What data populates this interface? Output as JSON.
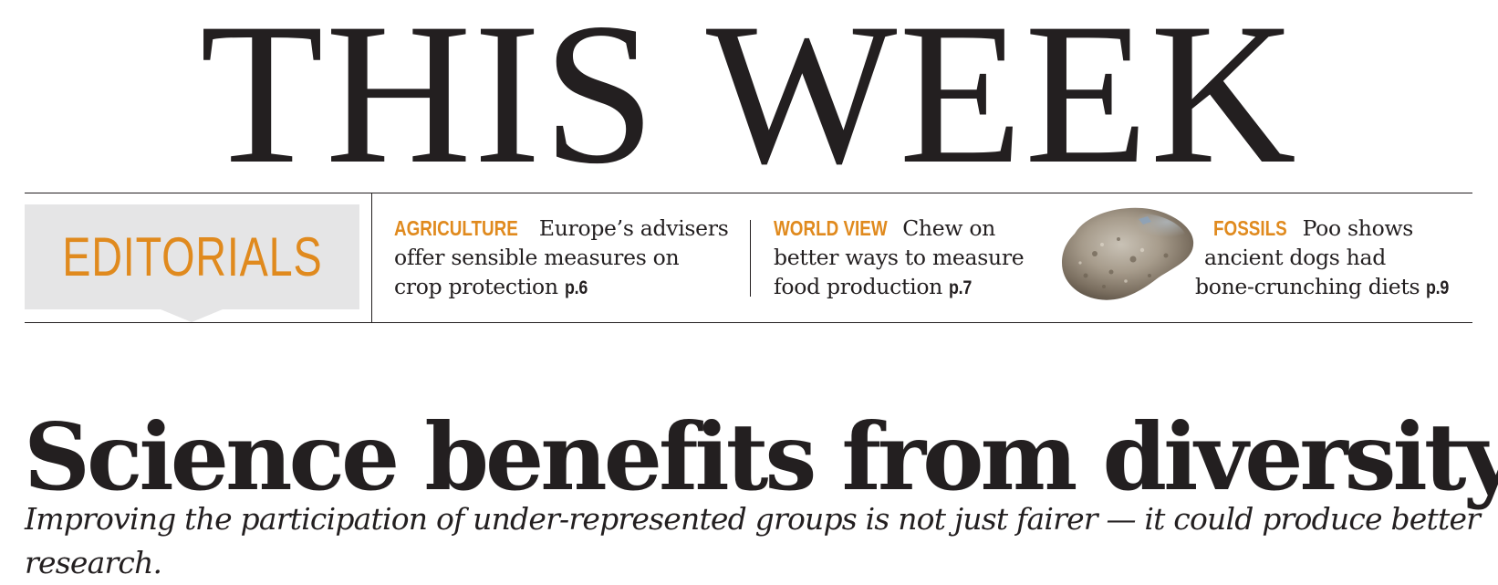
{
  "masthead": {
    "title": "THIS WEEK"
  },
  "section": {
    "label": "EDITORIALS",
    "colors": {
      "accent": "#e08a1e",
      "tab_background": "#e5e5e6",
      "text": "#231f20"
    }
  },
  "teasers": [
    {
      "kicker": "AGRICULTURE",
      "lines": [
        "Europe’s advisers",
        "offer sensible measures on",
        "crop protection"
      ],
      "page": "p.6"
    },
    {
      "kicker": "WORLD VIEW",
      "lines": [
        "Chew on",
        "better ways to measure",
        "food production"
      ],
      "page": "p.7"
    },
    {
      "kicker": "FOSSILS",
      "lines": [
        "Poo shows",
        "ancient dogs had",
        "bone-crunching diets"
      ],
      "page": "p.9",
      "image_icon": "fossil-coprolite-image"
    }
  ],
  "article": {
    "headline": "Science benefits from diversity",
    "standfirst": "Improving the participation of under-represented groups is not just fairer — it could produce better research."
  }
}
